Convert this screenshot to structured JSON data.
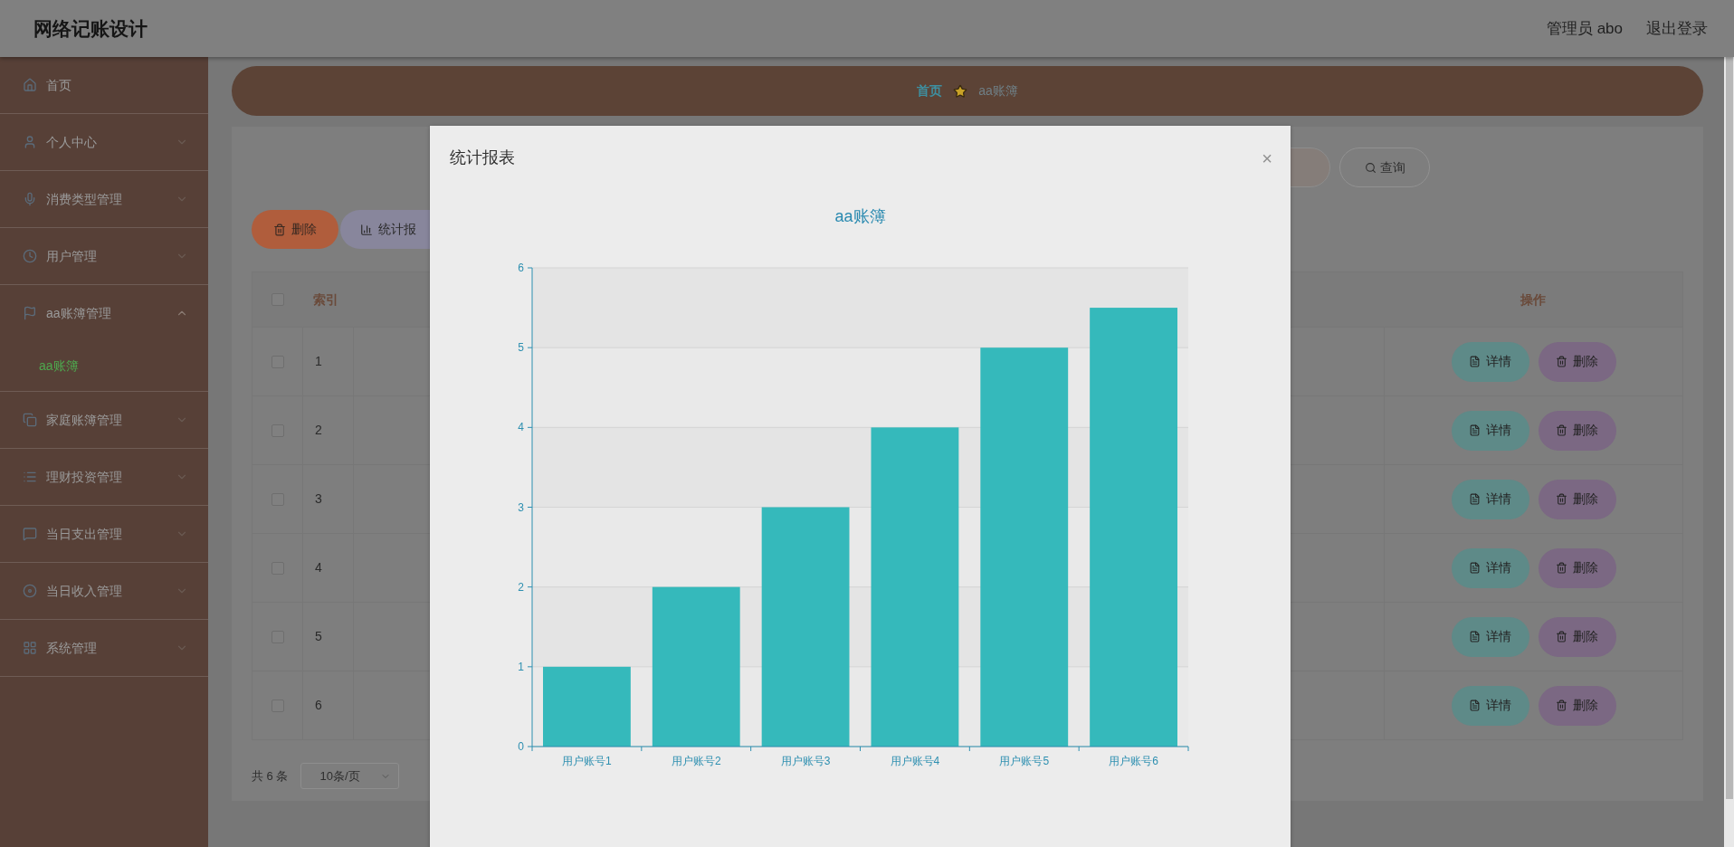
{
  "header": {
    "title": "网络记账设计",
    "user": "管理员 abo",
    "logout": "退出登录"
  },
  "sidebar": {
    "items": [
      {
        "label": "首页"
      },
      {
        "label": "个人中心",
        "expanded": false
      },
      {
        "label": "消费类型管理",
        "expanded": false
      },
      {
        "label": "用户管理",
        "expanded": false
      },
      {
        "label": "aa账簿管理",
        "expanded": true,
        "children": [
          {
            "label": "aa账簿",
            "selected": true
          }
        ]
      },
      {
        "label": "家庭账簿管理",
        "expanded": false
      },
      {
        "label": "理财投资管理",
        "expanded": false
      },
      {
        "label": "当日支出管理",
        "expanded": false
      },
      {
        "label": "当日收入管理",
        "expanded": false
      },
      {
        "label": "系统管理",
        "expanded": false
      }
    ]
  },
  "breadcrumb": [
    "首页",
    "aa账簿"
  ],
  "search_button": "查询",
  "toolbar": {
    "delete": "删除",
    "stats": "统计报"
  },
  "table": {
    "header_checked": false,
    "columns": [
      "索引",
      "操作"
    ],
    "rows": [
      {
        "index": "1",
        "checked": false,
        "actions": [
          "详情",
          "删除"
        ]
      },
      {
        "index": "2",
        "checked": false,
        "actions": [
          "详情",
          "删除"
        ]
      },
      {
        "index": "3",
        "checked": false,
        "actions": [
          "详情",
          "删除"
        ]
      },
      {
        "index": "4",
        "checked": false,
        "actions": [
          "详情",
          "删除"
        ]
      },
      {
        "index": "5",
        "checked": false,
        "actions": [
          "详情",
          "删除"
        ]
      },
      {
        "index": "6",
        "checked": false,
        "actions": [
          "详情",
          "删除"
        ]
      }
    ]
  },
  "pagination": {
    "total": "共 6 条",
    "page_size": "10条/页"
  },
  "modal": {
    "title": "统计报表",
    "close": "×",
    "chart_data": {
      "type": "bar",
      "title": "aa账簿",
      "grid": true,
      "categories": [
        "用户账号1",
        "用户账号2",
        "用户账号3",
        "用户账号4",
        "用户账号5",
        "用户账号6"
      ],
      "series": [
        {
          "color": "#35b9bb",
          "values": [
            1,
            2,
            3,
            4,
            5,
            5.5
          ]
        }
      ],
      "ylim": [
        0,
        6
      ],
      "yticks": [
        0,
        1,
        2,
        3,
        4,
        5,
        6
      ]
    }
  }
}
